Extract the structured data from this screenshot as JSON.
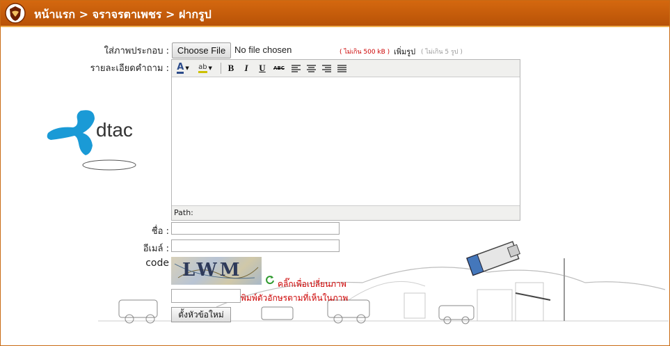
{
  "header": {
    "crumb_home": "หน้าแรก",
    "sep1": ">",
    "crumb_board": "จราจรตาเพชร",
    "sep2": ">",
    "crumb_current": "ฝากรูป"
  },
  "form": {
    "image_label": "ใส่ภาพประกอบ :",
    "file_button": "Choose File",
    "file_status": "No file chosen",
    "size_limit": "( ไม่เกิน 500 kB )",
    "add_image_link": "เพิ่มรูป",
    "count_limit": "( ไม่เกิน 5 รูป )",
    "details_label": "รายละเอียดคำถาม :",
    "editor_path": "Path:",
    "name_label": "ชื่อ :",
    "name_value": "",
    "email_label": "อีเมล์ :",
    "email_value": "",
    "code_label": "code",
    "captcha_text": "LWM",
    "refresh_link": "คลิ๊กเพื่อเปลี่ยนภาพ",
    "code_value": "",
    "code_hint": "พิมพ์ตัวอักษรตามที่เห็นในภาพ",
    "submit_button": "ตั้งหัวข้อใหม่"
  },
  "editor_toolbar": {
    "bold": "B",
    "italic": "I",
    "underline": "U",
    "strike": "ABC",
    "text_color": "A",
    "highlight": "ab"
  },
  "brand": {
    "logo_text": "dtac",
    "logo_color": "#1a9ad6"
  },
  "colors": {
    "header": "#c65d0b",
    "accent_red": "#cc0000"
  }
}
